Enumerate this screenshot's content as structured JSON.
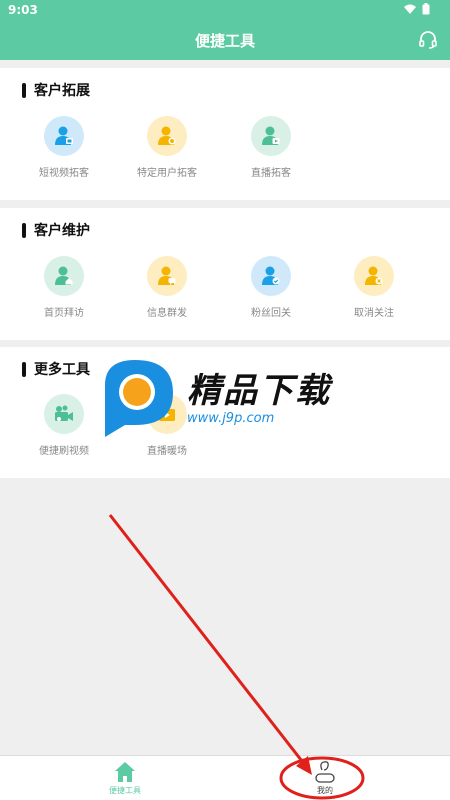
{
  "status_bar": {
    "time": "9:03"
  },
  "header": {
    "title": "便捷工具"
  },
  "sections": [
    {
      "title": "客户拓展",
      "items": [
        {
          "label": "短视频拓客",
          "icon": "user-video-icon",
          "color": "#1aa0e6"
        },
        {
          "label": "特定用户拓客",
          "icon": "user-search-icon",
          "color": "#f5b400"
        },
        {
          "label": "直播拓客",
          "icon": "user-live-icon",
          "color": "#4cbf96"
        }
      ]
    },
    {
      "title": "客户维护",
      "items": [
        {
          "label": "首页拜访",
          "icon": "user-home-icon",
          "color": "#4cbf96"
        },
        {
          "label": "信息群发",
          "icon": "user-message-icon",
          "color": "#f5b400"
        },
        {
          "label": "粉丝回关",
          "icon": "user-follow-icon",
          "color": "#1aa0e6"
        },
        {
          "label": "取消关注",
          "icon": "user-unfollow-icon",
          "color": "#f5b400"
        }
      ]
    },
    {
      "title": "更多工具",
      "items": [
        {
          "label": "便捷刷视频",
          "icon": "video-camera-icon",
          "color": "#4cbf96"
        },
        {
          "label": "直播暖场",
          "icon": "live-warmup-icon",
          "color": "#f5b400"
        }
      ]
    }
  ],
  "watermark": {
    "text": "精品下载",
    "url": "www.j9p.com"
  },
  "bottom_nav": [
    {
      "label": "便捷工具",
      "icon": "home-icon",
      "active": true
    },
    {
      "label": "我的",
      "icon": "profile-icon",
      "active": false
    }
  ],
  "colors": {
    "primary": "#5ccaa3",
    "annotation": "#e0201a"
  }
}
